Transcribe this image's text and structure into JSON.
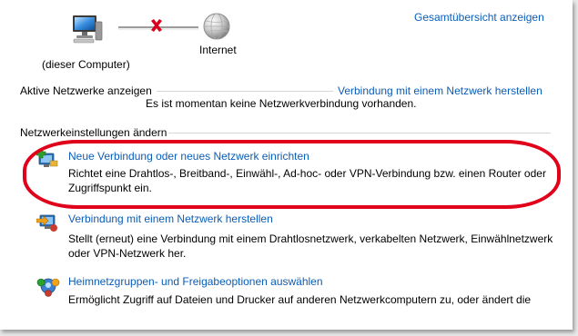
{
  "top_link": "Gesamtübersicht anzeigen",
  "map": {
    "computer_label": "(dieser Computer)",
    "internet_label": "Internet",
    "status": "disconnected"
  },
  "active_networks": {
    "label": "Aktive Netzwerke anzeigen",
    "connect_link": "Verbindung mit einem Netzwerk herstellen",
    "none_message": "Es ist momentan keine Netzwerkverbindung vorhanden."
  },
  "settings": {
    "label": "Netzwerkeinstellungen ändern",
    "items": [
      {
        "icon": "new-connection-icon",
        "title": "Neue Verbindung oder neues Netzwerk einrichten",
        "desc_line1": "Richtet eine Drahtlos-, Breitband-, Einwähl-, Ad-hoc- oder VPN-Verbindung bzw. einen Router oder",
        "desc_line2": "Zugriffspunkt ein."
      },
      {
        "icon": "connect-network-icon",
        "title": "Verbindung mit einem Netzwerk herstellen",
        "desc_line1": "Stellt (erneut) eine Verbindung mit einem Drahtlosnetzwerk, verkabelten Netzwerk, Einwählnetzwerk",
        "desc_line2": "oder VPN-Netzwerk her."
      },
      {
        "icon": "homegroup-icon",
        "title": "Heimnetzgruppen- und Freigabeoptionen auswählen",
        "desc_line1": "Ermöglicht Zugriff auf Dateien und Drucker auf anderen Netzwerkcomputern zu, oder ändert die"
      }
    ]
  },
  "colors": {
    "link": "#0a5db8",
    "highlight": "#e0001a",
    "disconnect_x": "#d9001b"
  }
}
